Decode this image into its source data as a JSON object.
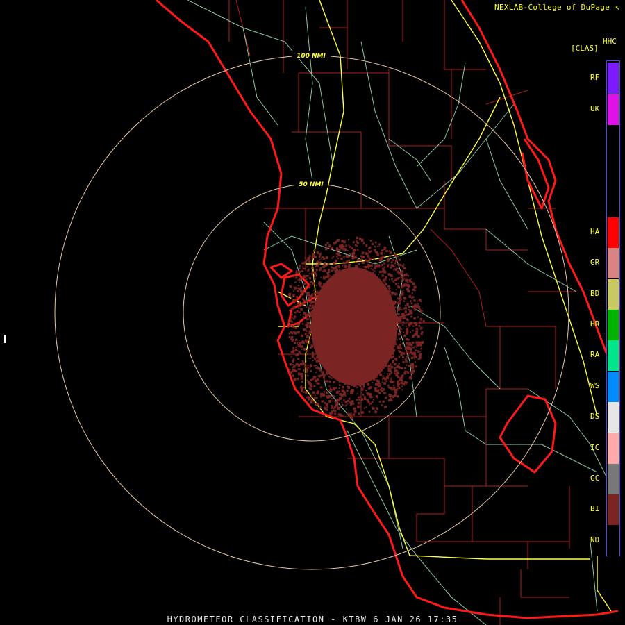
{
  "header": {
    "credit": "NEXLAB-College of DuPage ⇱"
  },
  "footer": {
    "caption": "HYDROMETEOR CLASSIFICATION - KTBW 6 JAN 26 17:35"
  },
  "range_rings": {
    "inner_label": "50 NMI",
    "outer_label": "100 NMI"
  },
  "legend": {
    "product": "HHC",
    "units": "[CLAS]",
    "classes": [
      {
        "code": "RF",
        "color": "#7a1cff"
      },
      {
        "code": "UK",
        "color": "#e010e8"
      },
      {
        "code": "HA",
        "color": "#ff0000"
      },
      {
        "code": "GR",
        "color": "#d98484"
      },
      {
        "code": "BD",
        "color": "#c8c864"
      },
      {
        "code": "HR",
        "color": "#00b400"
      },
      {
        "code": "RA",
        "color": "#00e68c"
      },
      {
        "code": "WS",
        "color": "#008cff"
      },
      {
        "code": "DS",
        "color": "#e6e6e6"
      },
      {
        "code": "IC",
        "color": "#ffaaaa"
      },
      {
        "code": "GC",
        "color": "#787878"
      },
      {
        "code": "BI",
        "color": "#7a2424"
      },
      {
        "code": "ND",
        "color": "#000000"
      }
    ]
  },
  "colors": {
    "coast": "#ff1a1a",
    "county": "#b41e1e",
    "highway": "#ffff40",
    "road": "#8cc8a0",
    "ring": "#e8c8a8",
    "echo": "#7a2424"
  }
}
